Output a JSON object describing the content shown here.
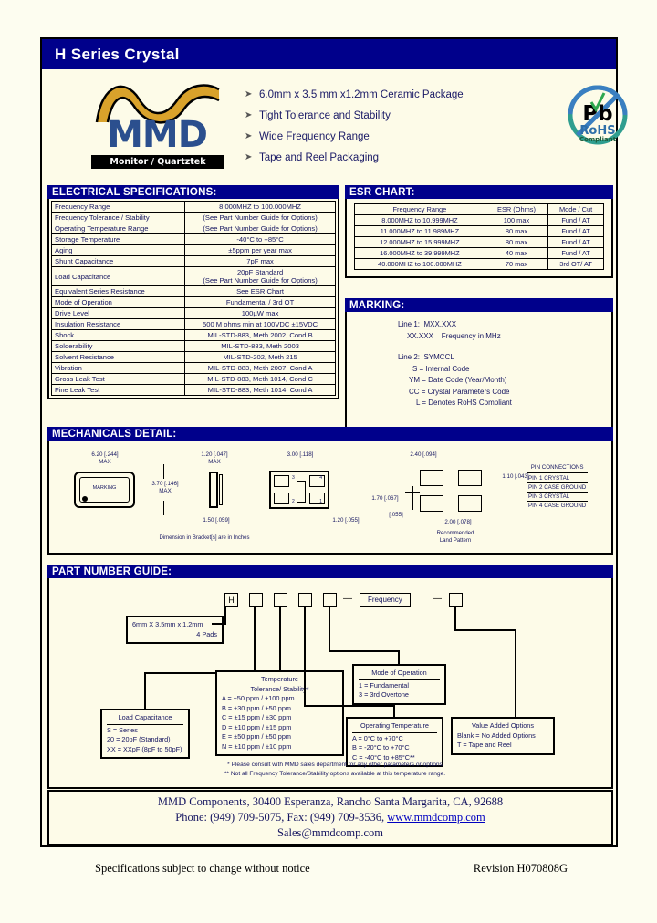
{
  "header": {
    "title": "H Series Crystal",
    "logo_text": "MMD",
    "logo_sub": "Monitor / Quartztek",
    "rohs_pb": "Pb",
    "rohs_label": "RoHS",
    "rohs_sub": "Compliant",
    "features": [
      "6.0mm x 3.5 mm x1.2mm Ceramic Package",
      "Tight Tolerance and Stability",
      "Wide Frequency Range",
      "Tape and Reel Packaging"
    ]
  },
  "electrical": {
    "heading": "ELECTRICAL SPECIFICATIONS:",
    "rows": [
      {
        "label": "Frequency Range",
        "value": "8.000MHZ to 100.000MHZ"
      },
      {
        "label": "Frequency Tolerance / Stability",
        "value": "(See Part Number Guide for Options)"
      },
      {
        "label": "Operating Temperature Range",
        "value": "(See Part Number Guide for Options)"
      },
      {
        "label": "Storage Temperature",
        "value": "-40°C to +85°C"
      },
      {
        "label": "Aging",
        "value": "±5ppm per year max"
      },
      {
        "label": "Shunt Capacitance",
        "value": "7pF max"
      },
      {
        "label": "Load Capacitance",
        "value": "20pF Standard\n(See Part Number Guide for Options)"
      },
      {
        "label": "Equivalent Series Resistance",
        "value": "See ESR Chart"
      },
      {
        "label": "Mode of Operation",
        "value": "Fundamental / 3rd OT"
      },
      {
        "label": "Drive Level",
        "value": "100µW max"
      },
      {
        "label": "Insulation Resistance",
        "value": "500 M ohms min at 100VDC ±15VDC"
      },
      {
        "label": "Shock",
        "value": "MIL-STD-883, Meth 2002, Cond B"
      },
      {
        "label": "Solderability",
        "value": "MIL-STD-883, Meth 2003"
      },
      {
        "label": "Solvent Resistance",
        "value": "MIL-STD-202, Meth 215"
      },
      {
        "label": "Vibration",
        "value": "MIL-STD-883, Meth 2007, Cond A"
      },
      {
        "label": "Gross Leak Test",
        "value": "MIL-STD-883, Meth 1014, Cond C"
      },
      {
        "label": "Fine Leak Test",
        "value": "MIL-STD-883, Meth 1014, Cond A"
      }
    ]
  },
  "esr": {
    "heading": "ESR CHART:",
    "columns": [
      "Frequency Range",
      "ESR (Ohms)",
      "Mode / Cut"
    ],
    "rows": [
      [
        "8.000MHZ to 10.999MHZ",
        "100 max",
        "Fund / AT"
      ],
      [
        "11.000MHZ to 11.989MHZ",
        "80 max",
        "Fund / AT"
      ],
      [
        "12.000MHZ to 15.999MHZ",
        "80 max",
        "Fund / AT"
      ],
      [
        "16.000MHZ to 39.999MHZ",
        "40 max",
        "Fund / AT"
      ],
      [
        "40.000MHZ to 100.000MHZ",
        "70 max",
        "3rd OT/ AT"
      ]
    ]
  },
  "marking": {
    "heading": "MARKING:",
    "line1": "Line 1:  MXX.XXX",
    "line1_sub": "XX.XXX    Frequency in MHz",
    "line2": "Line 2:  SYMCCL",
    "line2_items": [
      "S = Internal Code",
      "YM = Date Code (Year/Month)",
      "CC = Crystal Parameters Code",
      "L = Denotes RoHS Compliant"
    ]
  },
  "mechanical": {
    "heading": "MECHANICALS DETAIL:",
    "dims": {
      "width_top": "6.20 [.244]",
      "width_top_note": "MAX",
      "thick_top": "1.20 [.047]",
      "thick_top_note": "MAX",
      "height_side": "3.70 [.146]",
      "height_side_note": "MAX",
      "bottom_width": "3.00 [.118]",
      "side_thick": "1.50 [.059]",
      "pad_w": "1.20 [.055]",
      "land_a": "2.40 [.094]",
      "land_b": "1.10 [.043]",
      "land_c": "2.00 [.078]",
      "land_d": "[.055]",
      "land_e": "1.70 [.067]"
    },
    "pin_header": "PIN CONNECTIONS",
    "pins": [
      "PIN 1    CRYSTAL",
      "PIN 2    CASE GROUND",
      "PIN 3    CRYSTAL",
      "PIN 4    CASE GROUND"
    ],
    "marking_label": "MARKING",
    "note": "Dimension in Bracket[s] are in Inches",
    "note2": "Recommended\nLand Pattern"
  },
  "part_number": {
    "heading": "PART NUMBER GUIDE:",
    "prefix_code": "H",
    "frequency_label": "Frequency",
    "dash": "—",
    "package_box": "6mm X 3.5mm x 1.2mm\n4 Pads",
    "load_cap": {
      "title": "Load Capacitance",
      "items": [
        "S = Series",
        "20 = 20pF (Standard)",
        "XX = XXpF (8pF to 50pF)"
      ]
    },
    "temperature": {
      "title": "Temperature",
      "subtitle": "Tolerance/ Stability*",
      "items": [
        "A = ±50 ppm / ±100 ppm",
        "B = ±30 ppm / ±50 ppm",
        "C = ±15 ppm / ±30 ppm",
        "D = ±10 ppm / ±15 ppm",
        "E = ±50 ppm / ±50 ppm",
        "N = ±10 ppm / ±10 ppm"
      ]
    },
    "mode": {
      "title": "Mode of Operation",
      "items": [
        "1 =  Fundamental",
        "3 = 3rd Overtone"
      ]
    },
    "op_temp": {
      "title": "Operating Temperature",
      "items": [
        "A = 0°C to +70°C",
        "B = -20°C to +70°C",
        "C = -40°C to +85°C**"
      ]
    },
    "value_added": {
      "title": "Value Added Options",
      "items": [
        "Blank = No Added Options",
        "T = Tape and Reel"
      ]
    },
    "footnote1": "*  Please consult with MMD sales department for any other parameters or options",
    "footnote2": "**  Not all Frequency Tolerance/Stability options available at this temperature range."
  },
  "footer": {
    "address": "MMD Components, 30400 Esperanza, Rancho Santa Margarita, CA, 92688",
    "phone_prefix": "Phone: (949) 709-5075, Fax: (949) 709-3536, ",
    "website": "www.mmdcomp.com",
    "email": "Sales@mmdcomp.com",
    "disclaimer": "Specifications subject to change without notice",
    "revision": "Revision H070808G"
  }
}
